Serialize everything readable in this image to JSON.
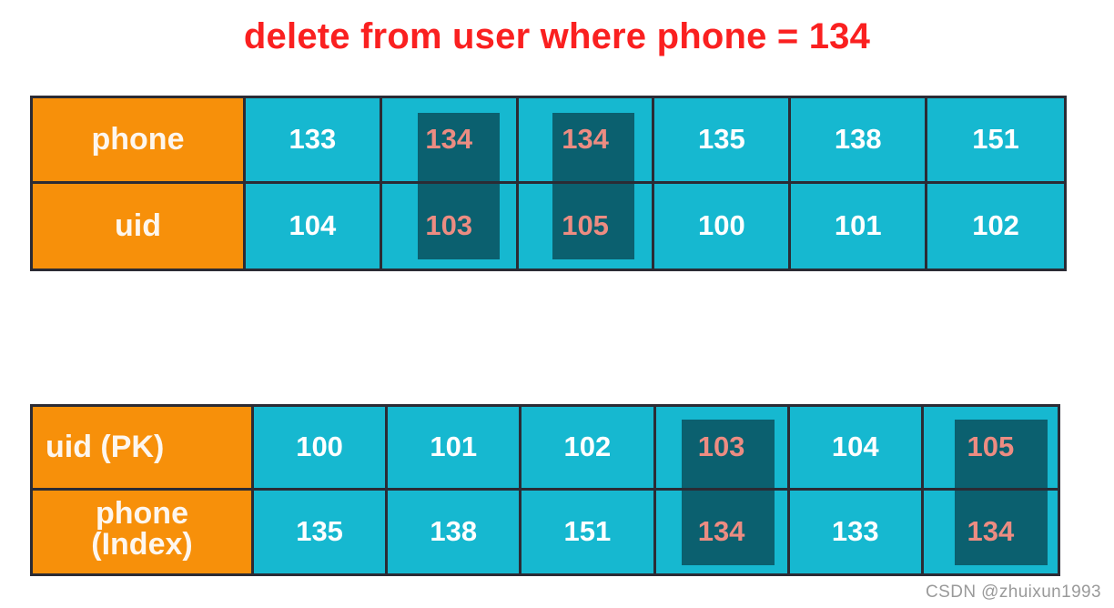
{
  "title": "delete from user where phone = 134",
  "colors": {
    "title": "#fa2020",
    "label_cell": "#f7900a",
    "data_cell": "#16b8d0",
    "highlight": "#0b606f",
    "highlight_text": "#ec8c82",
    "normal_text": "#ffffff",
    "border": "#2b2b34",
    "watermark": "#9a9a9a"
  },
  "top_table": {
    "rows": [
      {
        "label": "phone",
        "values": [
          "133",
          "134",
          "134",
          "135",
          "138",
          "151"
        ]
      },
      {
        "label": "uid",
        "values": [
          "104",
          "103",
          "105",
          "100",
          "101",
          "102"
        ]
      }
    ],
    "highlighted_columns": [
      1,
      2
    ]
  },
  "bottom_table": {
    "rows": [
      {
        "label": "uid  (PK)",
        "label_line1": "uid  (PK)",
        "label_line2": "",
        "values": [
          "100",
          "101",
          "102",
          "103",
          "104",
          "105"
        ]
      },
      {
        "label": "phone (Index)",
        "label_line1": "phone",
        "label_line2": "(Index)",
        "values": [
          "135",
          "138",
          "151",
          "134",
          "133",
          "134"
        ]
      }
    ],
    "highlighted_columns": [
      3,
      5
    ]
  },
  "watermark": "CSDN @zhuixun1993"
}
